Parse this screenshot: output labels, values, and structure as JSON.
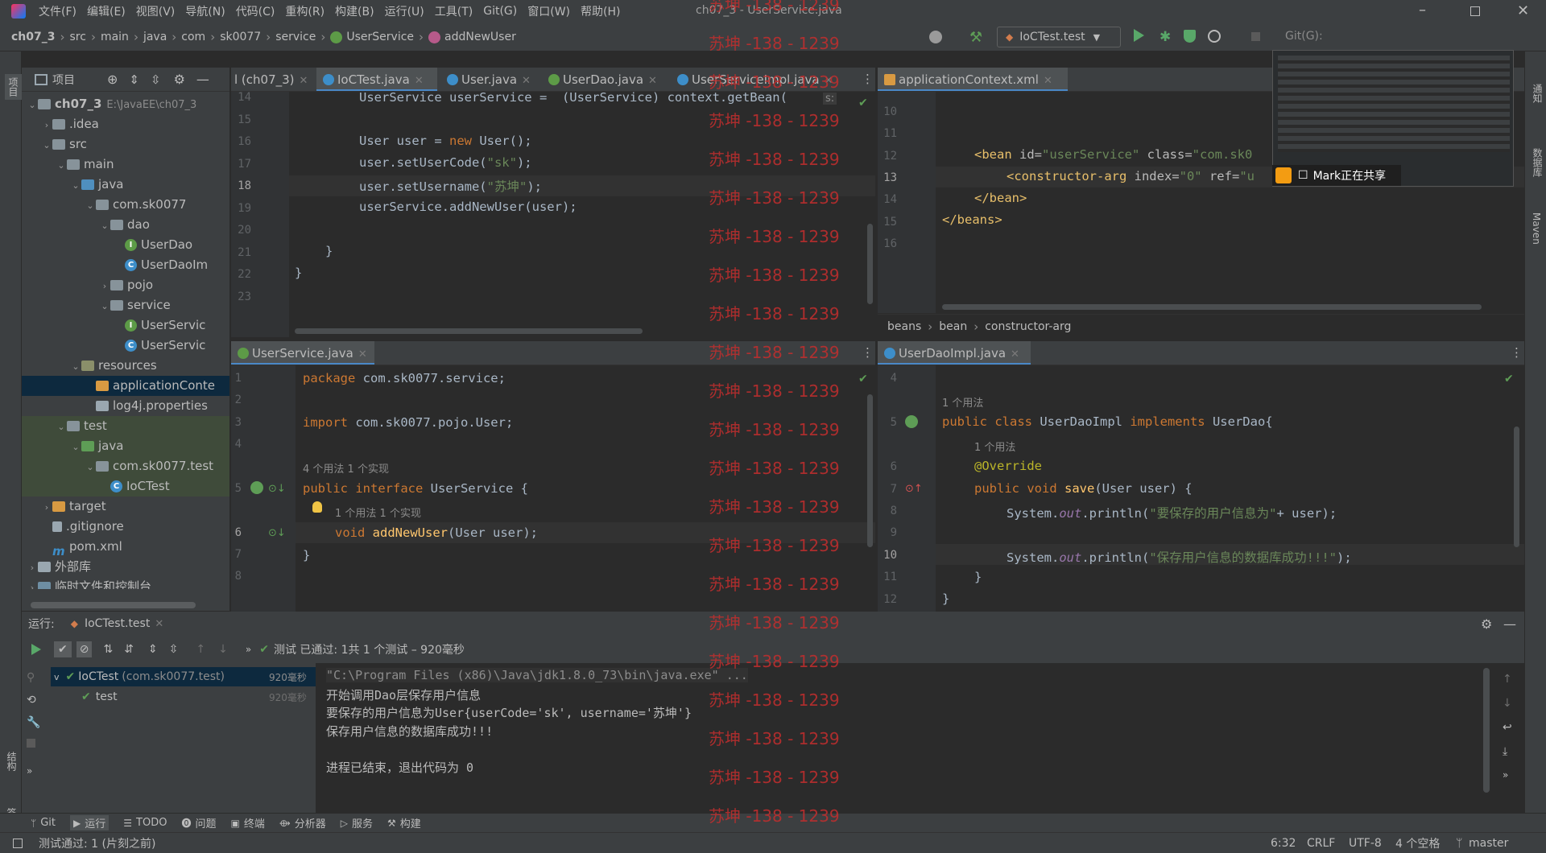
{
  "menu": {
    "app_title": "IntelliJ IDEA",
    "items": [
      "文件(F)",
      "编辑(E)",
      "视图(V)",
      "导航(N)",
      "代码(C)",
      "重构(R)",
      "构建(B)",
      "运行(U)",
      "工具(T)",
      "Git(G)",
      "窗口(W)",
      "帮助(H)"
    ],
    "window_title": "ch07_3 - UserService.java"
  },
  "breadcrumb": [
    "ch07_3",
    "src",
    "main",
    "java",
    "com",
    "sk0077",
    "service",
    "UserService",
    "addNewUser"
  ],
  "run_config": "IoCTest.test",
  "git_label": "Git(G):",
  "project": {
    "tool_label": "项目",
    "root_name": "ch07_3",
    "root_path": "E:\\JavaEE\\ch07_3",
    "tree": [
      {
        "label": "ch07_3",
        "depth": 0,
        "arrow": "v",
        "icon": "folder"
      },
      {
        "label": ".idea",
        "depth": 1,
        "arrow": ">",
        "icon": "folder"
      },
      {
        "label": "src",
        "depth": 1,
        "arrow": "v",
        "icon": "folder"
      },
      {
        "label": "main",
        "depth": 2,
        "arrow": "v",
        "icon": "folder"
      },
      {
        "label": "java",
        "depth": 3,
        "arrow": "v",
        "icon": "folder-src"
      },
      {
        "label": "com.sk0077",
        "depth": 4,
        "arrow": "v",
        "icon": "package"
      },
      {
        "label": "dao",
        "depth": 5,
        "arrow": "v",
        "icon": "package"
      },
      {
        "label": "UserDao",
        "depth": 6,
        "arrow": "",
        "icon": "interface"
      },
      {
        "label": "UserDaoIm",
        "depth": 6,
        "arrow": "",
        "icon": "class"
      },
      {
        "label": "pojo",
        "depth": 5,
        "arrow": ">",
        "icon": "package"
      },
      {
        "label": "service",
        "depth": 5,
        "arrow": "v",
        "icon": "package"
      },
      {
        "label": "UserServic",
        "depth": 6,
        "arrow": "",
        "icon": "interface"
      },
      {
        "label": "UserServic",
        "depth": 6,
        "arrow": "",
        "icon": "class"
      },
      {
        "label": "resources",
        "depth": 3,
        "arrow": "v",
        "icon": "folder-res"
      },
      {
        "label": "applicationConte",
        "depth": 4,
        "arrow": "",
        "icon": "xml"
      },
      {
        "label": "log4j.properties",
        "depth": 4,
        "arrow": "",
        "icon": "props"
      },
      {
        "label": "test",
        "depth": 2,
        "arrow": "v",
        "icon": "folder"
      },
      {
        "label": "java",
        "depth": 3,
        "arrow": "v",
        "icon": "folder-test"
      },
      {
        "label": "com.sk0077.test",
        "depth": 4,
        "arrow": "v",
        "icon": "package"
      },
      {
        "label": "IoCTest",
        "depth": 5,
        "arrow": "",
        "icon": "class"
      },
      {
        "label": "target",
        "depth": 1,
        "arrow": ">",
        "icon": "folder-target"
      },
      {
        "label": ".gitignore",
        "depth": 1,
        "arrow": "",
        "icon": "file"
      },
      {
        "label": "pom.xml",
        "depth": 1,
        "arrow": "",
        "icon": "maven"
      },
      {
        "label": "外部库",
        "depth": 0,
        "arrow": ">",
        "icon": "library"
      },
      {
        "label": "临时文件和控制台",
        "depth": 0,
        "arrow": ">",
        "icon": "scratch"
      }
    ]
  },
  "editor_top_left": {
    "tabs": [
      "l (ch07_3)",
      "IoCTest.java",
      "User.java",
      "UserDao.java",
      "UserServiceImpl.java"
    ],
    "lines": [
      "14",
      "15",
      "16",
      "17",
      "18",
      "19",
      "20",
      "21",
      "22",
      "23"
    ],
    "code_line14": "UserService userService =  (UserService) context.getBean(",
    "code_user_new": "User user = new User();",
    "code_setcode": "user.setUserCode(\"sk\");",
    "code_setname": "user.setUsername(\"苏坤\");",
    "code_add": "userService.addNewUser(user);",
    "code_close1": "}",
    "code_close2": "}",
    "hint_s": "s:"
  },
  "editor_top_right": {
    "tab": "applicationContext.xml",
    "lines": [
      "10",
      "11",
      "12",
      "13",
      "14",
      "15",
      "16"
    ],
    "code_bean_open": "<bean id=\"userService\" class=\"com.sk0",
    "code_ctor": "<constructor-arg index=\"0\" ref=\"u",
    "code_bean_close": "</bean>",
    "code_beans_close": "</beans>",
    "crumbs": [
      "beans",
      "bean",
      "constructor-arg"
    ]
  },
  "editor_bottom_left": {
    "tab": "UserService.java",
    "lines": [
      "1",
      "2",
      "3",
      "4",
      "5",
      "6",
      "7",
      "8"
    ],
    "code_package": "package com.sk0077.service;",
    "code_import": "import com.sk0077.pojo.User;",
    "hint_usage": "4 个用法   1 个实现",
    "code_interface": "public interface UserService {",
    "hint_usage2": "1 个用法   1 个实现",
    "code_method": "void addNewUser(User user);",
    "code_close": "}"
  },
  "editor_bottom_right": {
    "tab": "UserDaoImpl.java",
    "lines": [
      "4",
      "5",
      "6",
      "7",
      "8",
      "9",
      "10",
      "11",
      "12"
    ],
    "hint_usage": "1 个用法",
    "code_class": "public class UserDaoImpl implements UserDao{",
    "hint_usage2": "1 个用法",
    "code_override": "@Override",
    "code_save": "public void save(User user) {",
    "code_print1": "System.out.println(\"要保存的用户信息为\"+ user);",
    "code_print2": "System.out.println(\"保存用户信息的数据库成功!!!\");",
    "code_close1": "}",
    "code_close2": "}"
  },
  "share_popup": {
    "label": "Mark正在共享"
  },
  "run": {
    "label": "运行:",
    "tab": "IoCTest.test",
    "status": "测试 已通过: 1共 1 个测试 – 920毫秒",
    "tree": [
      {
        "label": "IoCTest",
        "sub": "(com.sk0077.test)",
        "time": "920毫秒"
      },
      {
        "label": "test",
        "sub": "",
        "time": "920毫秒"
      }
    ],
    "console": [
      "\"C:\\Program Files (x86)\\Java\\jdk1.8.0_73\\bin\\java.exe\" ...",
      "开始调用Dao层保存用户信息",
      "要保存的用户信息为User{userCode='sk', username='苏坤'}",
      "保存用户信息的数据库成功!!!",
      "",
      "进程已结束，退出代码为 0"
    ]
  },
  "bottom_tools": [
    "Git",
    "运行",
    "TODO",
    "问题",
    "终端",
    "分析器",
    "服务",
    "构建"
  ],
  "status": {
    "message": "测试通过: 1 (片刻之前)",
    "position": "6:32",
    "line_sep": "CRLF",
    "encoding": "UTF-8",
    "indent": "4 个空格",
    "branch": "master"
  },
  "side_tools": {
    "left": [
      "项目",
      "结构",
      "书签"
    ],
    "right": [
      "通知",
      "数据库",
      "Maven"
    ]
  },
  "watermark": "苏坤 -138 - 1239",
  "colors": {
    "accent": "#4a88c7",
    "keyword": "#cc7832",
    "string": "#6a8759",
    "method": "#ffc66d",
    "success": "#5e9d56"
  }
}
